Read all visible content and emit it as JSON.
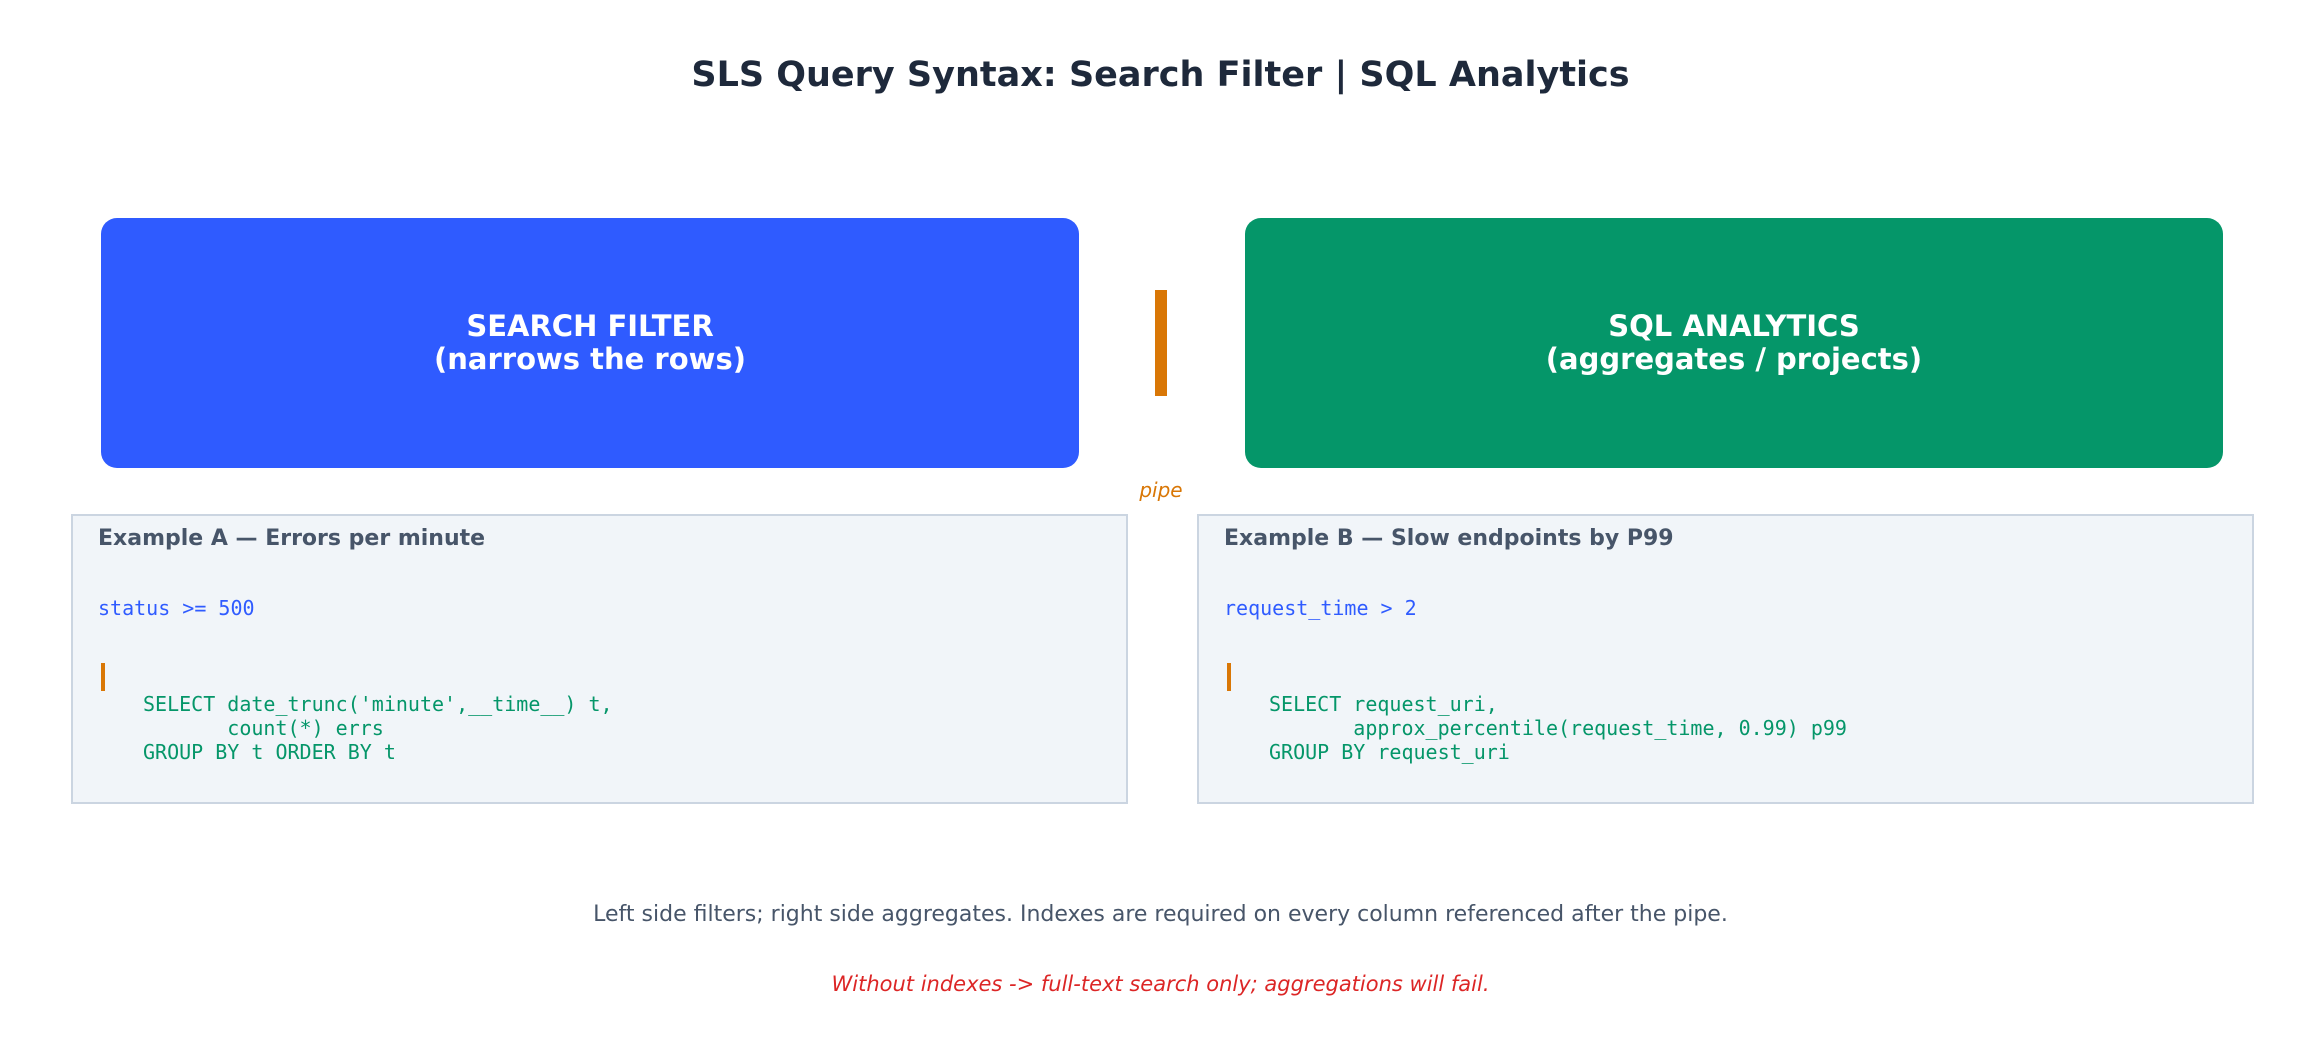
{
  "title": "SLS Query Syntax: Search Filter | SQL Analytics",
  "colors": {
    "search": "#2f5bff",
    "sql": "#059669",
    "pipe": "#d97706",
    "warning": "#dc2626"
  },
  "search_box": {
    "line1": "SEARCH FILTER",
    "line2": "(narrows the rows)"
  },
  "pipe_label": "pipe",
  "sql_box": {
    "line1": "SQL ANALYTICS",
    "line2": "(aggregates / projects)"
  },
  "example_a": {
    "title": "Example A — Errors per minute",
    "filter": "status >= 500",
    "sql": "SELECT date_trunc('minute',__time__) t,\n       count(*) errs\nGROUP BY t ORDER BY t"
  },
  "example_b": {
    "title": "Example B — Slow endpoints by P99",
    "filter": "request_time > 2",
    "sql": "SELECT request_uri,\n       approx_percentile(request_time, 0.99) p99\nGROUP BY request_uri"
  },
  "note": "Left side filters; right side aggregates. Indexes are required on every column referenced after the pipe.",
  "warning": "Without indexes -> full-text search only; aggregations will fail."
}
